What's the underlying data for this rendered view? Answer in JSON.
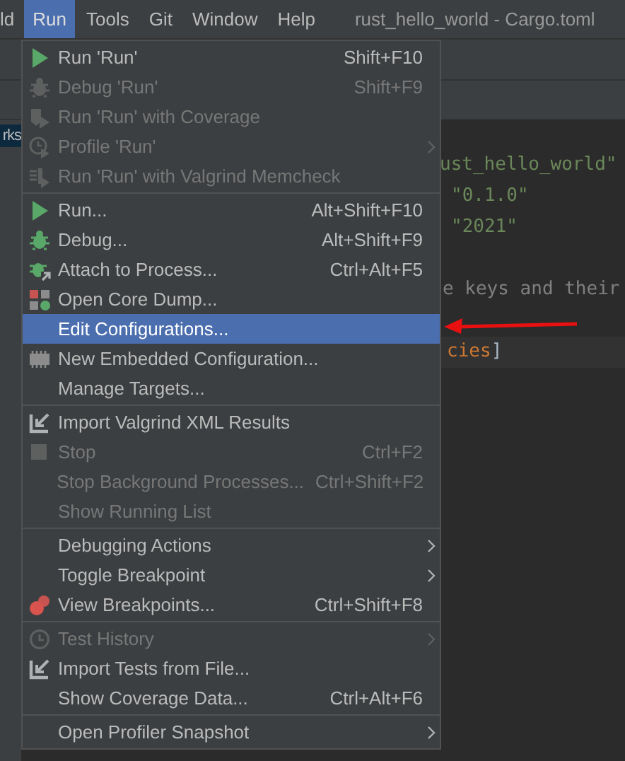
{
  "menu_bar": [
    {
      "label": "ld",
      "selected": false
    },
    {
      "label": "Run",
      "selected": true
    },
    {
      "label": "Tools",
      "selected": false
    },
    {
      "label": "Git",
      "selected": false
    },
    {
      "label": "Window",
      "selected": false
    },
    {
      "label": "Help",
      "selected": false
    }
  ],
  "window": {
    "title": "rust_hello_world - Cargo.toml"
  },
  "project_tree": {
    "item": "rks"
  },
  "editor": {
    "lines": [
      {
        "segments": [
          {
            "text": "ust_hello_world\"",
            "kind": "string"
          }
        ]
      },
      {
        "segments": [
          {
            "text": "\"0.1.0\"",
            "kind": "string"
          }
        ]
      },
      {
        "segments": [
          {
            "text": "\"2021\"",
            "kind": "string"
          }
        ]
      },
      {
        "segments": [
          {
            "text": "e keys and their",
            "kind": "comment"
          }
        ]
      },
      {
        "segments": [
          {
            "text": "cies",
            "kind": "section"
          },
          {
            "text": "]",
            "kind": "plain"
          }
        ]
      }
    ]
  },
  "run_menu": {
    "groups": [
      {
        "items": [
          {
            "label": "Run 'Run'",
            "shortcut": "Shift+F10",
            "disabled": false,
            "selected": false,
            "submenu": false
          },
          {
            "label": "Debug 'Run'",
            "shortcut": "Shift+F9",
            "disabled": true,
            "selected": false,
            "submenu": false
          },
          {
            "label": "Run 'Run' with Coverage",
            "disabled": true,
            "selected": false,
            "submenu": false
          },
          {
            "label": "Profile 'Run'",
            "disabled": true,
            "selected": false,
            "submenu": true
          },
          {
            "label": "Run 'Run' with Valgrind Memcheck",
            "disabled": true,
            "selected": false,
            "submenu": false
          }
        ]
      },
      {
        "items": [
          {
            "label": "Run...",
            "shortcut": "Alt+Shift+F10",
            "disabled": false,
            "selected": false,
            "submenu": false
          },
          {
            "label": "Debug...",
            "shortcut": "Alt+Shift+F9",
            "disabled": false,
            "selected": false,
            "submenu": false
          },
          {
            "label": "Attach to Process...",
            "shortcut": "Ctrl+Alt+F5",
            "disabled": false,
            "selected": false,
            "submenu": false
          },
          {
            "label": "Open Core Dump...",
            "disabled": false,
            "selected": false,
            "submenu": false
          },
          {
            "label": "Edit Configurations...",
            "disabled": false,
            "selected": true,
            "submenu": false
          },
          {
            "label": "New Embedded Configuration...",
            "disabled": false,
            "selected": false,
            "submenu": false
          },
          {
            "label": "Manage Targets...",
            "disabled": false,
            "selected": false,
            "submenu": false
          }
        ]
      },
      {
        "items": [
          {
            "label": "Import Valgrind XML Results",
            "disabled": false,
            "selected": false,
            "submenu": false
          },
          {
            "label": "Stop",
            "shortcut": "Ctrl+F2",
            "disabled": true,
            "selected": false,
            "submenu": false
          },
          {
            "label": "Stop Background Processes...",
            "shortcut": "Ctrl+Shift+F2",
            "disabled": true,
            "selected": false,
            "submenu": false
          },
          {
            "label": "Show Running List",
            "disabled": true,
            "selected": false,
            "submenu": false
          }
        ]
      },
      {
        "items": [
          {
            "label": "Debugging Actions",
            "disabled": false,
            "selected": false,
            "submenu": true
          },
          {
            "label": "Toggle Breakpoint",
            "disabled": false,
            "selected": false,
            "submenu": true
          },
          {
            "label": "View Breakpoints...",
            "shortcut": "Ctrl+Shift+F8",
            "disabled": false,
            "selected": false,
            "submenu": false
          }
        ]
      },
      {
        "items": [
          {
            "label": "Test History",
            "disabled": true,
            "selected": false,
            "submenu": true
          },
          {
            "label": "Import Tests from File...",
            "disabled": false,
            "selected": false,
            "submenu": false
          },
          {
            "label": "Show Coverage Data...",
            "shortcut": "Ctrl+Alt+F6",
            "disabled": false,
            "selected": false,
            "submenu": false
          }
        ]
      },
      {
        "items": [
          {
            "label": "Open Profiler Snapshot",
            "disabled": false,
            "selected": false,
            "submenu": true
          }
        ]
      }
    ]
  }
}
